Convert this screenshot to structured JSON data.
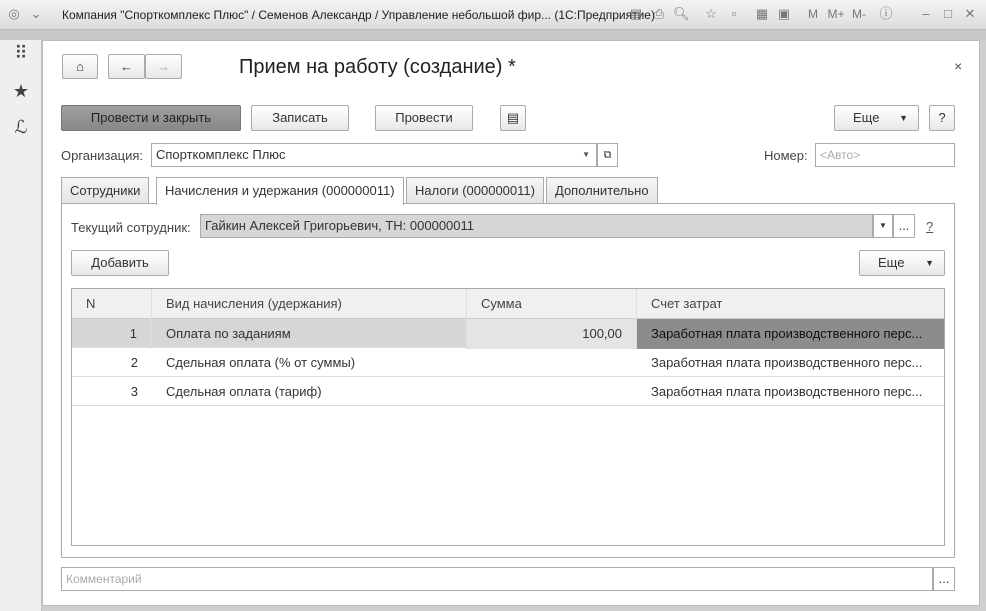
{
  "window": {
    "title": "Компания \"Спорткомплекс Плюс\" / Семенов Александр / Управление небольшой фир...  (1С:Предприятие)",
    "m": "M",
    "mplus": "M+",
    "mminus": "M-"
  },
  "form": {
    "title": "Прием на работу (создание) *",
    "close": "×"
  },
  "toolbar": {
    "post_close": "Провести и закрыть",
    "save": "Записать",
    "post": "Провести",
    "more": "Еще",
    "help": "?"
  },
  "header": {
    "org_label": "Организация:",
    "org_value": "Спорткомплекс Плюс",
    "number_label": "Номер:",
    "number_placeholder": "<Авто>"
  },
  "tabs": [
    {
      "label": "Сотрудники"
    },
    {
      "label": "Начисления и удержания (000000011)"
    },
    {
      "label": "Налоги (000000011)"
    },
    {
      "label": "Дополнительно"
    }
  ],
  "accruals": {
    "employee_label": "Текущий сотрудник:",
    "employee_value": "Гайкин Алексей Григорьевич, ТН: 000000011",
    "help": "?",
    "add": "Добавить",
    "more": "Еще",
    "ellipsis": "...",
    "columns": [
      "N",
      "Вид начисления (удержания)",
      "Сумма",
      "Счет затрат"
    ],
    "rows": [
      {
        "n": "1",
        "kind": "Оплата по заданиям",
        "sum": "100,00",
        "account": "Заработная плата производственного перс..."
      },
      {
        "n": "2",
        "kind": "Сдельная оплата (% от суммы)",
        "sum": "",
        "account": "Заработная плата производственного перс..."
      },
      {
        "n": "3",
        "kind": "Сдельная оплата (тариф)",
        "sum": "",
        "account": "Заработная плата производственного перс..."
      }
    ]
  },
  "comment": {
    "placeholder": "Комментарий",
    "ellipsis": "..."
  }
}
